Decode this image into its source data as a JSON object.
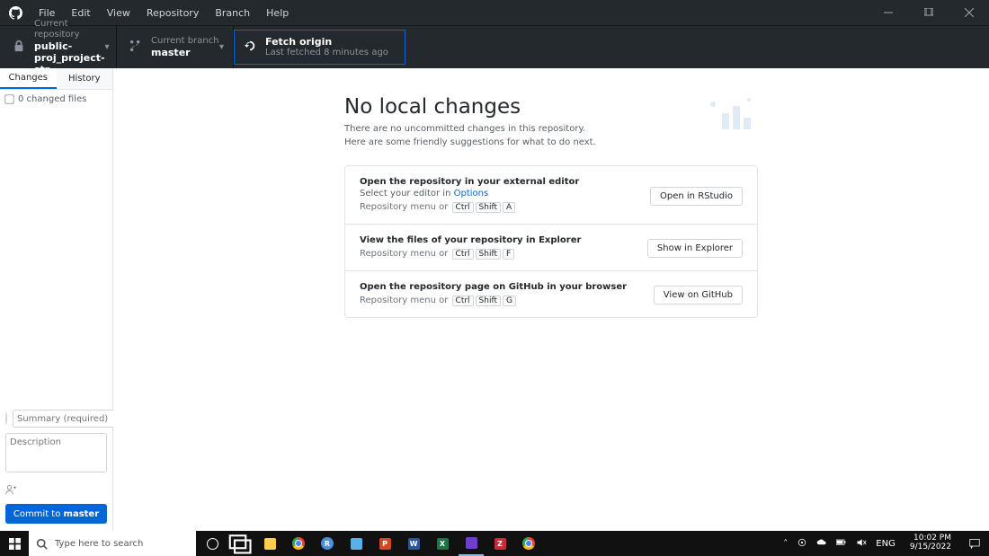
{
  "menubar": {
    "items": [
      "File",
      "Edit",
      "View",
      "Repository",
      "Branch",
      "Help"
    ]
  },
  "toolbar": {
    "repo": {
      "label": "Current repository",
      "value": "public-proj_project-str"
    },
    "branch": {
      "label": "Current branch",
      "value": "master"
    },
    "fetch": {
      "title": "Fetch origin",
      "subtitle": "Last fetched 8 minutes ago"
    }
  },
  "sidebar": {
    "tabs": {
      "changes": "Changes",
      "history": "History"
    },
    "changed_files": "0 changed files",
    "commit": {
      "summary_placeholder": "Summary (required)",
      "description_placeholder": "Description",
      "button_prefix": "Commit to ",
      "button_branch": "master"
    }
  },
  "main": {
    "heading": "No local changes",
    "subtitle": "There are no uncommitted changes in this repository. Here are some friendly suggestions for what to do next.",
    "cards": [
      {
        "title": "Open the repository in your external editor",
        "desc_pre": "Select your editor in ",
        "desc_link": "Options",
        "shortcut_prefix": "Repository menu or",
        "keys": [
          "Ctrl",
          "Shift",
          "A"
        ],
        "action": "Open in RStudio"
      },
      {
        "title": "View the files of your repository in Explorer",
        "shortcut_prefix": "Repository menu or",
        "keys": [
          "Ctrl",
          "Shift",
          "F"
        ],
        "action": "Show in Explorer"
      },
      {
        "title": "Open the repository page on GitHub in your browser",
        "shortcut_prefix": "Repository menu or",
        "keys": [
          "Ctrl",
          "Shift",
          "G"
        ],
        "action": "View on GitHub"
      }
    ]
  },
  "taskbar": {
    "search_placeholder": "Type here to search",
    "lang": "ENG",
    "time": "10:02 PM",
    "date": "9/15/2022"
  }
}
